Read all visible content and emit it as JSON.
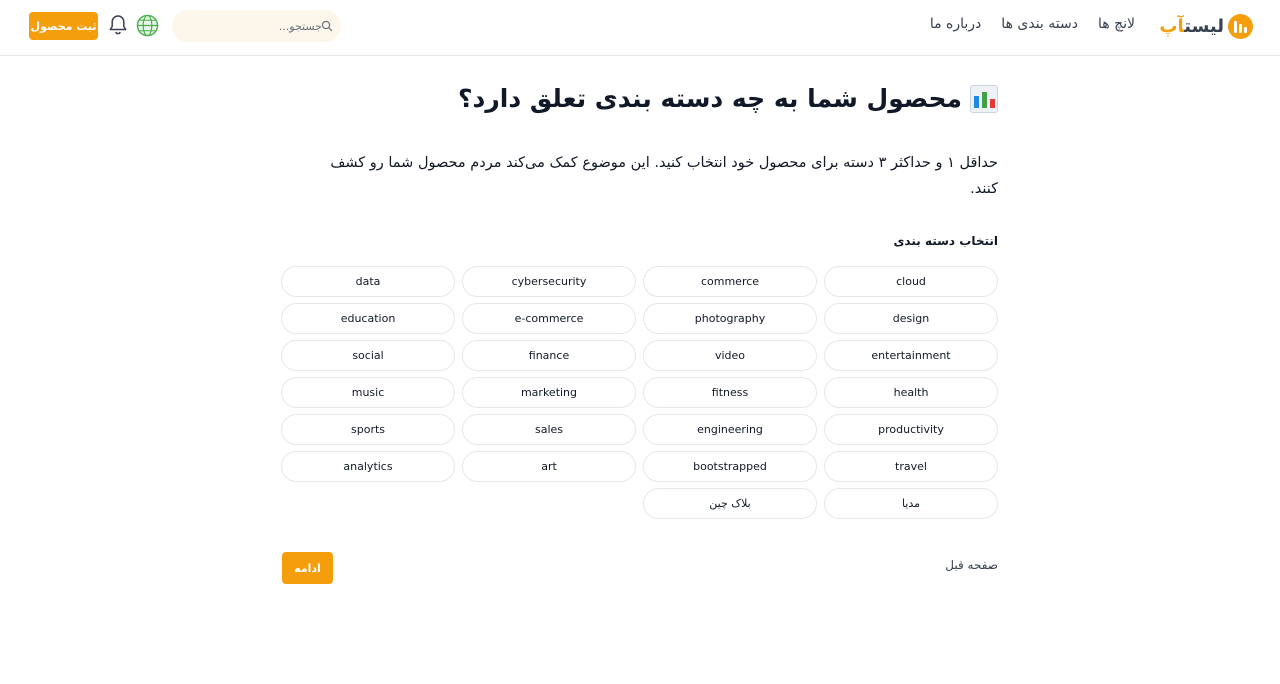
{
  "header": {
    "logo_prefix": "لیست",
    "logo_accent": "آپ",
    "nav": [
      "لانچ ها",
      "دسته بندی ها",
      "درباره ما"
    ],
    "search_placeholder": "جستجو...",
    "submit_label": "ثبت محصول"
  },
  "main": {
    "title": "محصول شما به چه دسته بندی تعلق دارد؟",
    "description": "حداقل ۱ و حداکثر ۳ دسته برای محصول خود انتخاب کنید. این موضوع کمک می‌کند مردم محصول شما رو کشف کنند.",
    "section_label": "انتخاب دسته بندی",
    "categories": [
      "cloud",
      "commerce",
      "cybersecurity",
      "data",
      "design",
      "photography",
      "e-commerce",
      "education",
      "entertainment",
      "video",
      "finance",
      "social",
      "health",
      "fitness",
      "marketing",
      "music",
      "productivity",
      "engineering",
      "sales",
      "sports",
      "travel",
      "bootstrapped",
      "art",
      "analytics",
      "مدیا",
      "بلاک چین"
    ],
    "prev_label": "صفحه قبل",
    "continue_label": "ادامه"
  },
  "colors": {
    "accent": "#f59e0b",
    "border": "#e5e7eb",
    "text": "#111827"
  }
}
